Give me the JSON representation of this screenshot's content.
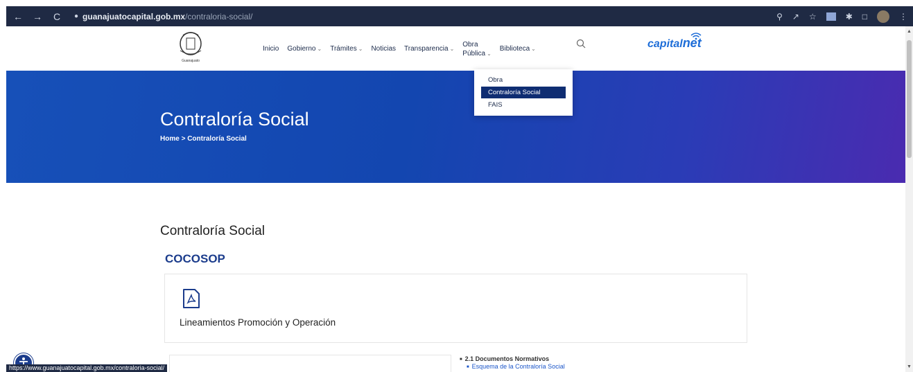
{
  "browser": {
    "url_host": "guanajuatocapital.gob.mx",
    "url_path": "/contraloria-social/",
    "status_url": "https://www.guanajuatocapital.gob.mx/contraloria-social/"
  },
  "header": {
    "logo_text": "Guanajuato",
    "nav": [
      {
        "label": "Inicio"
      },
      {
        "label": "Gobierno"
      },
      {
        "label": "Trámites"
      },
      {
        "label": "Noticias"
      },
      {
        "label": "Transparencia"
      },
      {
        "label_top": "Obra",
        "label_bottom": "Pública"
      },
      {
        "label": "Biblioteca"
      }
    ],
    "brand_main": "capital",
    "brand_sub": "net"
  },
  "dropdown": {
    "items": [
      "Obra",
      "Contraloría Social",
      "FAIS"
    ],
    "active_index": 1
  },
  "hero": {
    "title": "Contraloría Social",
    "breadcrumb_home": "Home",
    "breadcrumb_sep": ">",
    "breadcrumb_current": "Contraloría Social"
  },
  "content": {
    "section_title": "Contraloría Social",
    "subheading": "COCOSOP",
    "card_label": "Lineamientos Promoción y Operación",
    "list_item": "2.1 Documentos Normativos",
    "list_subitem": "Esquema de la Contraloría Social"
  },
  "colors": {
    "chrome_bg": "#1f2a44",
    "accent_blue": "#1b3c8c",
    "dropdown_active": "#0f2d72",
    "link_blue": "#1b56c9"
  }
}
